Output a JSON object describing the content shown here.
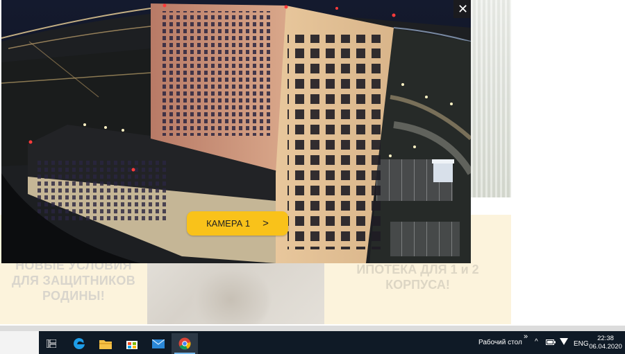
{
  "background": {
    "banner_left_text": "НОВЫЕ УСЛОВИЯ ДЛЯ ЗАЩИТНИКОВ РОДИНЫ!",
    "banner_right_text": "ИПОТЕКА ДЛЯ 1 и 2 КОРПУСА!"
  },
  "modal": {
    "close_label": "✕",
    "camera_button_label": "КАМЕРА 1",
    "camera_button_arrow": ">"
  },
  "taskbar": {
    "icons": [
      "task-view-icon",
      "edge-icon",
      "file-explorer-icon",
      "store-icon",
      "mail-icon",
      "chrome-icon"
    ],
    "desktop_label": "Рабочий стол",
    "tray_chevron": "»",
    "tray_up": "^",
    "language": "ENG",
    "time": "22:38",
    "date": "06.04.2020"
  },
  "colors": {
    "accent_button": "#f9c21a",
    "taskbar": "#0f1a26",
    "banner": "#fcf3dc"
  }
}
